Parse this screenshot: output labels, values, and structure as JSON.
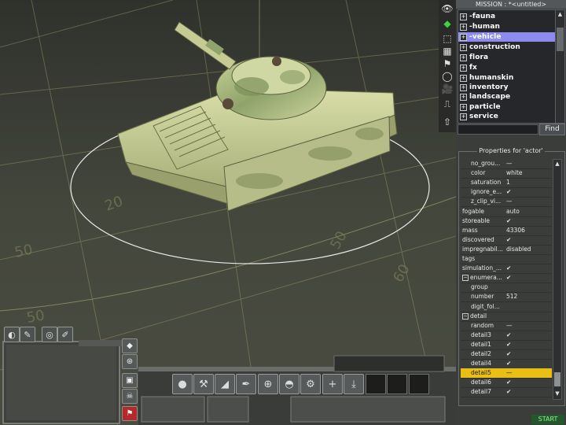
{
  "mission": {
    "title": "MISSION : *<untitled>"
  },
  "toolbar": {
    "tools": [
      {
        "icon": "eye-icon",
        "glyph": "👁"
      },
      {
        "icon": "diamond-select-icon",
        "glyph": "◆"
      },
      {
        "icon": "dotted-select-icon",
        "glyph": "⬚"
      },
      {
        "icon": "grid-select-icon",
        "glyph": "▦"
      },
      {
        "icon": "flag-icon",
        "glyph": "⚑"
      },
      {
        "icon": "circle-icon",
        "glyph": "◯"
      },
      {
        "icon": "camera-icon",
        "glyph": "🎥"
      },
      {
        "icon": "step-icon",
        "glyph": "⎍"
      },
      {
        "icon": "arrow-up-icon",
        "glyph": "⇧"
      }
    ]
  },
  "tree": {
    "items": [
      {
        "label": "-fauna",
        "selected": false
      },
      {
        "label": "-human",
        "selected": false
      },
      {
        "label": "-vehicle",
        "selected": true
      },
      {
        "label": "construction",
        "selected": false
      },
      {
        "label": "flora",
        "selected": false
      },
      {
        "label": "fx",
        "selected": false
      },
      {
        "label": "humanskin",
        "selected": false
      },
      {
        "label": "inventory",
        "selected": false
      },
      {
        "label": "landscape",
        "selected": false
      },
      {
        "label": "particle",
        "selected": false
      },
      {
        "label": "service",
        "selected": false
      }
    ],
    "find_label": "Find",
    "find_value": ""
  },
  "properties": {
    "title": "Properties for 'actor'",
    "rows": [
      {
        "name": "no_grou...",
        "value": "—",
        "indent": 1
      },
      {
        "name": "color",
        "value": "white",
        "indent": 1
      },
      {
        "name": "saturation",
        "value": "1",
        "indent": 1
      },
      {
        "name": "ignore_e...",
        "value": "✔",
        "indent": 1
      },
      {
        "name": "z_clip_vi...",
        "value": "—",
        "indent": 1
      },
      {
        "name": "fogable",
        "value": "auto",
        "indent": 0
      },
      {
        "name": "storeable",
        "value": "✔",
        "indent": 0
      },
      {
        "name": "mass",
        "value": "43306",
        "indent": 0
      },
      {
        "name": "discovered",
        "value": "✔",
        "indent": 0
      },
      {
        "name": "impregnabil...",
        "value": "disabled",
        "indent": 0
      },
      {
        "name": "tags",
        "value": "",
        "indent": 0
      },
      {
        "name": "simulation_...",
        "value": "✔",
        "indent": 0
      },
      {
        "name": "enumera...",
        "value": "✔",
        "indent": 0,
        "expander": "−"
      },
      {
        "name": "group",
        "value": "",
        "indent": 1
      },
      {
        "name": "number",
        "value": "512",
        "indent": 1
      },
      {
        "name": "digit_fol...",
        "value": "",
        "indent": 1
      },
      {
        "name": "detail",
        "value": "",
        "indent": 0,
        "expander": "−"
      },
      {
        "name": "random",
        "value": "—",
        "indent": 1
      },
      {
        "name": "detail3",
        "value": "✔",
        "indent": 1
      },
      {
        "name": "detail1",
        "value": "✔",
        "indent": 1
      },
      {
        "name": "detail2",
        "value": "✔",
        "indent": 1
      },
      {
        "name": "detail4",
        "value": "✔",
        "indent": 1
      },
      {
        "name": "detail5",
        "value": "—",
        "indent": 1,
        "selected": true
      },
      {
        "name": "detail6",
        "value": "✔",
        "indent": 1
      },
      {
        "name": "detail7",
        "value": "✔",
        "indent": 1
      }
    ]
  },
  "start_label": "START",
  "ground_labels": [
    "20",
    "50",
    "60",
    "50",
    "50"
  ],
  "hud": {
    "order_buttons": [
      "◐",
      "✎",
      "◎",
      "✐"
    ],
    "action_icons": [
      "grenade-icon",
      "shovel-icon",
      "knife-icon",
      "pistol-icon",
      "crosshair-icon",
      "helmet-icon",
      "wrench-icon",
      "plus-icon",
      "drop-icon"
    ],
    "action_glyphs": [
      "●",
      "⚒",
      "◢",
      "✒",
      "⊕",
      "◓",
      "⚙",
      "+",
      "⤓"
    ]
  },
  "colors": {
    "selection": "#8c8cf0",
    "highlight": "#e9bf16",
    "start": "#23582d"
  }
}
